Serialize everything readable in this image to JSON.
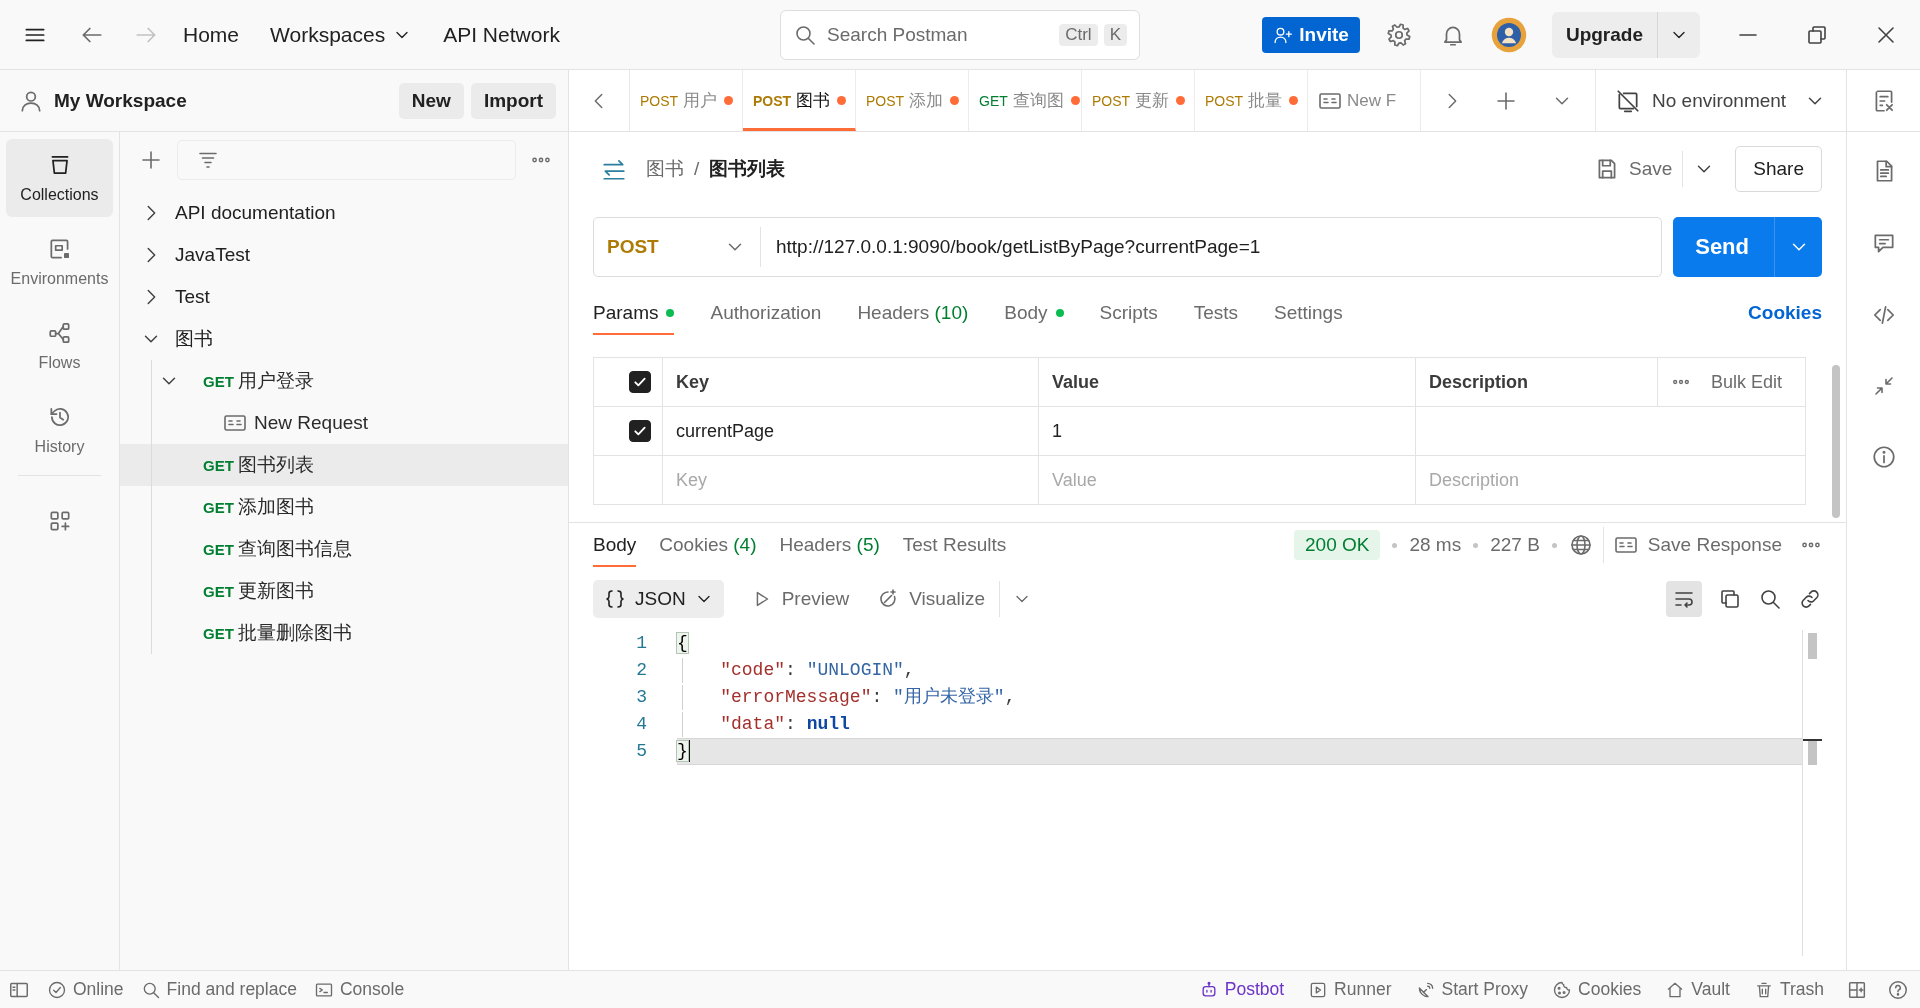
{
  "top_bar": {
    "back": {
      "disabled": false
    },
    "forward": {
      "disabled": true
    },
    "nav": [
      {
        "label": "Home",
        "dropdown": false
      },
      {
        "label": "Workspaces",
        "dropdown": true
      },
      {
        "label": "API Network",
        "dropdown": false
      }
    ],
    "search": {
      "placeholder": "Search Postman",
      "shortcut": [
        "Ctrl",
        "K"
      ]
    },
    "invite": "Invite",
    "upgrade": "Upgrade"
  },
  "workspace": {
    "name": "My Workspace",
    "buttons": [
      "New",
      "Import"
    ]
  },
  "rail": [
    {
      "label": "Collections",
      "selected": true
    },
    {
      "label": "Environments",
      "selected": false
    },
    {
      "label": "Flows",
      "selected": false
    },
    {
      "label": "History",
      "selected": false
    }
  ],
  "tree": [
    {
      "kind": "folder",
      "label": "API documentation",
      "expanded": false,
      "selected": false
    },
    {
      "kind": "folder",
      "label": "JavaTest",
      "expanded": false,
      "selected": false
    },
    {
      "kind": "folder",
      "label": "Test",
      "expanded": false,
      "selected": false
    },
    {
      "kind": "folder",
      "label": "图书",
      "expanded": true,
      "selected": false,
      "children": [
        {
          "kind": "request",
          "method": {
            "label": "GET",
            "color": "#007f31"
          },
          "label": "用户登录",
          "expanded": true,
          "selected": false,
          "children": [
            {
              "kind": "example",
              "label": "New Request",
              "selected": false
            }
          ]
        },
        {
          "kind": "request",
          "method": {
            "label": "GET",
            "color": "#007f31"
          },
          "label": "图书列表",
          "selected": true
        },
        {
          "kind": "request",
          "method": {
            "label": "GET",
            "color": "#007f31"
          },
          "label": "添加图书",
          "selected": false
        },
        {
          "kind": "request",
          "method": {
            "label": "GET",
            "color": "#007f31"
          },
          "label": "查询图书信息",
          "selected": false
        },
        {
          "kind": "request",
          "method": {
            "label": "GET",
            "color": "#007f31"
          },
          "label": "更新图书",
          "selected": false
        },
        {
          "kind": "request",
          "method": {
            "label": "GET",
            "color": "#007f31"
          },
          "label": "批量删除图书",
          "selected": false
        }
      ]
    }
  ],
  "open_tabs": [
    {
      "kind": "request",
      "method": {
        "label": "POST",
        "color": "#ad7a03"
      },
      "label": "用户",
      "unsaved": true,
      "selected": false
    },
    {
      "kind": "request",
      "method": {
        "label": "POST",
        "color": "#ad7a03"
      },
      "label": "图书",
      "unsaved": true,
      "selected": true
    },
    {
      "kind": "request",
      "method": {
        "label": "POST",
        "color": "#ad7a03"
      },
      "label": "添加",
      "unsaved": true,
      "selected": false
    },
    {
      "kind": "request",
      "method": {
        "label": "GET",
        "color": "#007f31"
      },
      "label": "查询图",
      "unsaved": true,
      "selected": false
    },
    {
      "kind": "request",
      "method": {
        "label": "POST",
        "color": "#ad7a03"
      },
      "label": "更新",
      "unsaved": true,
      "selected": false
    },
    {
      "kind": "request",
      "method": {
        "label": "POST",
        "color": "#ad7a03"
      },
      "label": "批量",
      "unsaved": true,
      "selected": false
    },
    {
      "kind": "example",
      "label": "New F",
      "unsaved": false,
      "selected": false
    }
  ],
  "environment": {
    "label": "No environment"
  },
  "request": {
    "breadcrumb": {
      "items": [
        "图书",
        "图书列表"
      ],
      "separator": "/"
    },
    "save": "Save",
    "share": "Share",
    "method": {
      "label": "POST",
      "color": "#ad7a03"
    },
    "url": "http://127.0.0.1:9090/book/getListByPage?currentPage=1",
    "send": "Send",
    "tabs": [
      {
        "label": "Params",
        "indicator": true,
        "selected": true
      },
      {
        "label": "Authorization",
        "indicator": false,
        "selected": false
      },
      {
        "label": "Headers",
        "count": "(10)",
        "indicator": false,
        "selected": false
      },
      {
        "label": "Body",
        "indicator": true,
        "selected": false
      },
      {
        "label": "Scripts",
        "indicator": false,
        "selected": false
      },
      {
        "label": "Tests",
        "indicator": false,
        "selected": false
      },
      {
        "label": "Settings",
        "indicator": false,
        "selected": false
      }
    ],
    "cookies": "Cookies",
    "params": {
      "columns": [
        "Key",
        "Value",
        "Description"
      ],
      "all_checked": true,
      "bulk_edit": "Bulk Edit",
      "rows": [
        {
          "checked": true,
          "key": "currentPage",
          "value": "1"
        }
      ],
      "new_row": [
        {
          "placeholder": "Key"
        },
        {
          "placeholder": "Value"
        },
        {
          "placeholder": "Description"
        }
      ]
    }
  },
  "response": {
    "tabs": [
      {
        "label": "Body",
        "selected": true
      },
      {
        "label": "Cookies",
        "count": "(4)",
        "selected": false
      },
      {
        "label": "Headers",
        "count": "(5)",
        "selected": false
      },
      {
        "label": "Test Results",
        "selected": false
      }
    ],
    "status": "200 OK",
    "time": "28 ms",
    "size": "227 B",
    "save_response": "Save Response",
    "format": "JSON",
    "preview": "Preview",
    "visualize": "Visualize",
    "wrap_lines": true,
    "lines": [
      {
        "number": "1",
        "current": false,
        "tokens": [
          {
            "kind": "bracket",
            "text": "{",
            "matched": true
          }
        ],
        "children": [
          {
            "number": "2",
            "current": false,
            "tokens": [
              {
                "kind": "key",
                "text": "\"code\""
              },
              {
                "kind": "punct",
                "text": ": "
              },
              {
                "kind": "string",
                "text": "\"UNLOGIN\""
              },
              {
                "kind": "punct",
                "text": ","
              }
            ]
          },
          {
            "number": "3",
            "current": false,
            "tokens": [
              {
                "kind": "key",
                "text": "\"errorMessage\""
              },
              {
                "kind": "punct",
                "text": ": "
              },
              {
                "kind": "string",
                "text": "\"用户未登录\""
              },
              {
                "kind": "punct",
                "text": ","
              }
            ]
          },
          {
            "number": "4",
            "current": false,
            "tokens": [
              {
                "kind": "key",
                "text": "\"data\""
              },
              {
                "kind": "punct",
                "text": ": "
              },
              {
                "kind": "keyword",
                "text": "null"
              }
            ]
          }
        ]
      },
      {
        "number": "5",
        "current": true,
        "tokens": [
          {
            "kind": "bracket",
            "text": "}",
            "matched": true
          }
        ]
      }
    ]
  },
  "status_bar": {
    "left": [
      {
        "label": "Online"
      },
      {
        "label": "Find and replace"
      },
      {
        "label": "Console"
      }
    ],
    "right": [
      {
        "label": "Postbot",
        "color": "#6b33c8"
      },
      {
        "label": "Runner",
        "color": "#6b6b6b"
      },
      {
        "label": "Start Proxy",
        "color": "#6b6b6b"
      },
      {
        "label": "Cookies",
        "color": "#6b6b6b"
      },
      {
        "label": "Vault",
        "color": "#6b6b6b"
      },
      {
        "label": "Trash",
        "color": "#6b6b6b"
      }
    ]
  }
}
